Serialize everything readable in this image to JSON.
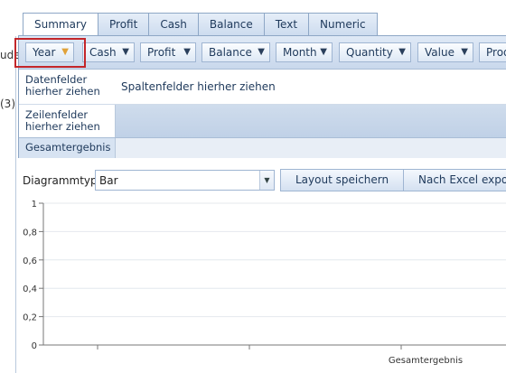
{
  "left_fragments": {
    "top": "ude",
    "mid": "(3)"
  },
  "tabs": [
    {
      "label": "Summary",
      "active": true
    },
    {
      "label": "Profit"
    },
    {
      "label": "Cash"
    },
    {
      "label": "Balance"
    },
    {
      "label": "Text"
    },
    {
      "label": "Numeric"
    }
  ],
  "fields": [
    {
      "label": "Year",
      "highlighted": true
    },
    {
      "label": "Cash"
    },
    {
      "label": "Profit"
    },
    {
      "label": "Balance"
    },
    {
      "label": "Month"
    },
    {
      "label": "Quantity"
    },
    {
      "label": "Value"
    },
    {
      "label": "Prod"
    }
  ],
  "pivot": {
    "data_drop": "Datenfelder hierher ziehen",
    "col_drop": "Spaltenfelder hierher ziehen",
    "row_drop": "Zeilenfelder hierher ziehen",
    "grand_total": "Gesamtergebnis"
  },
  "controls": {
    "chart_type_label": "Diagrammtyp",
    "chart_type_value": "Bar",
    "save_layout": "Layout speichern",
    "export_excel": "Nach Excel expor"
  },
  "chart_data": {
    "type": "bar",
    "categories": [
      "Gesamtergebnis"
    ],
    "series": [],
    "ylim": [
      0,
      1
    ],
    "yticks": [
      "0",
      "0,2",
      "0,4",
      "0,6",
      "0,8",
      "1"
    ],
    "grid": true
  }
}
